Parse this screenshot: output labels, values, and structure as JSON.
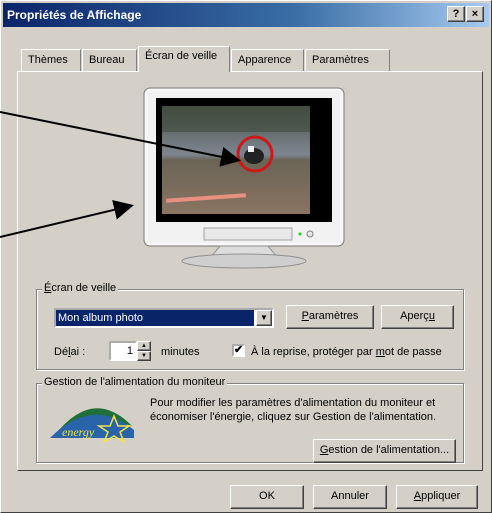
{
  "window": {
    "title": "Propriétés de Affichage",
    "help_label": "?",
    "close_label": "×"
  },
  "tabs": [
    {
      "label": "Thèmes"
    },
    {
      "label": "Bureau"
    },
    {
      "label": "Écran de veille",
      "active": true
    },
    {
      "label": "Apparence"
    },
    {
      "label": "Paramètres"
    }
  ],
  "screensaver_group": {
    "legend_first": "É",
    "legend_rest": "cran de veille",
    "selected": "Mon album photo",
    "settings_underline": "P",
    "settings_rest": "aramètres",
    "preview_main": "Aperç",
    "preview_underline": "u",
    "delay_prefix": "Dé",
    "delay_underline": "l",
    "delay_suffix": "ai :",
    "delay_value": "1",
    "minutes_label": "minutes",
    "password_checked": true,
    "password_prefix": "À la reprise, protéger par ",
    "password_underline": "m",
    "password_suffix": "ot de passe"
  },
  "power_group": {
    "legend": "Gestion de l'alimentation du moniteur",
    "description_line1": "Pour modifier les paramètres d'alimentation du moniteur et",
    "description_line2": "économiser l'énergie, cliquez sur Gestion de l'alimentation.",
    "button_underline": "G",
    "button_rest": "estion de l'alimentation...",
    "logo_text": "energy"
  },
  "footer": {
    "ok_label": "OK",
    "cancel_label": "Annuler",
    "apply_underline": "A",
    "apply_rest": "ppliquer"
  },
  "colors": {
    "title_start": "#0a246a",
    "title_end": "#a6caf0",
    "selection": "#0a246a",
    "annotation": "#000000",
    "circle": "#d01818"
  }
}
